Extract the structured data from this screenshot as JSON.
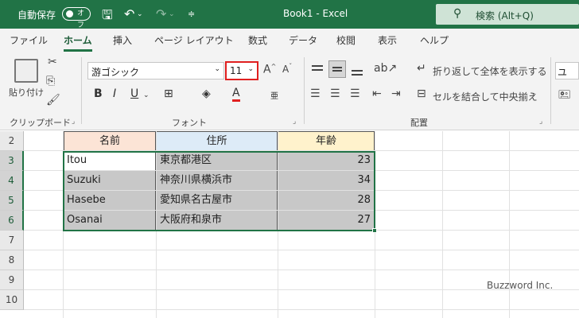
{
  "titlebar": {
    "autosave_label": "自動保存",
    "toggle_label": "オフ",
    "doc_title": "Book1  -  Excel",
    "search_label": "検索 (Alt+Q)"
  },
  "tabs": [
    "ファイル",
    "ホーム",
    "挿入",
    "ページ レイアウト",
    "数式",
    "データ",
    "校閲",
    "表示",
    "ヘルプ"
  ],
  "active_tab": "ホーム",
  "ribbon": {
    "clipboard": {
      "paste_label": "貼り付け",
      "group_label": "クリップボード"
    },
    "font": {
      "font_name": "游ゴシック",
      "font_size": "11",
      "bold": "B",
      "italic": "I",
      "underline": "U",
      "group_label": "フォント"
    },
    "alignment": {
      "wrap_text_label": "折り返して全体を表示する",
      "merge_label": "セルを結合して中央揃え",
      "group_label": "配置"
    },
    "number": {
      "format_preview": "ユーザ"
    }
  },
  "sheet": {
    "rows": [
      "2",
      "3",
      "4",
      "5",
      "6",
      "7",
      "8",
      "9",
      "10"
    ],
    "headers": {
      "name": "名前",
      "address": "住所",
      "age": "年齢"
    },
    "data": [
      {
        "name": "Itou",
        "address": "東京都港区",
        "age": "23"
      },
      {
        "name": "Suzuki",
        "address": "神奈川県横浜市",
        "age": "34"
      },
      {
        "name": "Hasebe",
        "address": "愛知県名古屋市",
        "age": "28"
      },
      {
        "name": "Osanai",
        "address": "大阪府和泉市",
        "age": "27"
      }
    ]
  },
  "watermark": "Buzzword Inc.",
  "colors": {
    "brand": "#217346",
    "highlight_box": "#e02020",
    "gray_fill": "#c8c8c8"
  }
}
